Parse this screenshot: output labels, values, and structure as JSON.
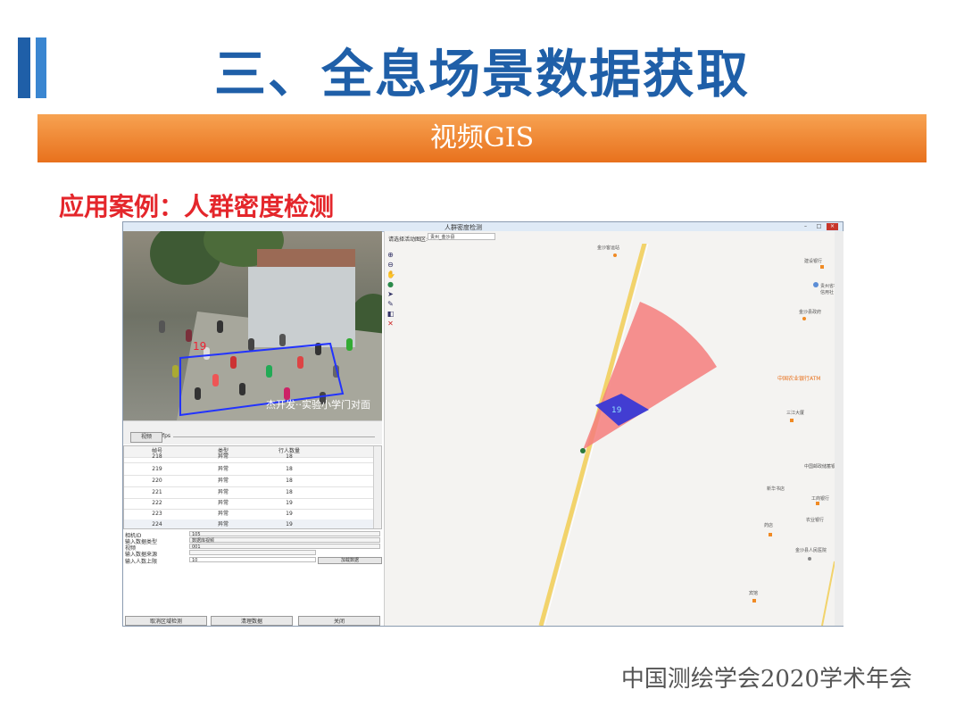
{
  "slide": {
    "title": "三、全息场景数据获取",
    "banner": "视频GIS",
    "case_label": "应用案例：人群密度检测",
    "footer": "中国测绘学会2020学术年会",
    "colors": {
      "title_blue": "#1f5fa8",
      "banner_orange": "#ef8a2c",
      "case_red": "#e4262b"
    }
  },
  "app": {
    "window_title": "人群密度检测",
    "window_buttons": {
      "minimize": "–",
      "maximize": "□",
      "close": "×"
    },
    "video": {
      "region_count": "19",
      "caption": "杰开发··实验小学门对面"
    },
    "controls": {
      "video_button": "视频",
      "fps_label": "fps"
    },
    "table": {
      "headers": [
        "帧号",
        "类型",
        "行人数量"
      ],
      "rows": [
        [
          "218",
          "异常",
          "18"
        ],
        [
          "219",
          "异常",
          "18"
        ],
        [
          "220",
          "异常",
          "18"
        ],
        [
          "221",
          "异常",
          "18"
        ],
        [
          "222",
          "异常",
          "19"
        ],
        [
          "223",
          "异常",
          "19"
        ],
        [
          "224",
          "异常",
          "19"
        ]
      ]
    },
    "form": {
      "camera_id_label": "相机ID",
      "camera_id_value": "105",
      "data_type_label": "输入数据类型",
      "data_type_value": "数据库视频",
      "video_label": "视频",
      "video_value": "001",
      "source_label": "输入数据来源",
      "source_value": "",
      "threshold_label": "输入人数上限",
      "threshold_value": "10",
      "browse_button": "加载数据"
    },
    "buttons": {
      "cancel_detect": "取消区域检测",
      "clear_data": "清理数据",
      "close": "关闭"
    },
    "map": {
      "district_label": "请选择活动图区:",
      "district_value": "贵州_金沙县",
      "tools": [
        "zoom-in-icon",
        "zoom-out-icon",
        "pan-icon",
        "globe-icon",
        "pointer-icon",
        "edit-icon",
        "layer-icon",
        "delete-icon"
      ],
      "region_count": "19",
      "pois": [
        {
          "name": "中国农业银行ATM"
        },
        {
          "name": "工商银行"
        },
        {
          "name": "金沙县政府"
        },
        {
          "name": "金沙县人民医院"
        },
        {
          "name": "三江大厦"
        },
        {
          "name": "中国邮政储蓄银行"
        },
        {
          "name": "建设银行"
        },
        {
          "name": "贵州省农村信用社"
        },
        {
          "name": "新华书店"
        },
        {
          "name": "农业银行"
        },
        {
          "name": "药店"
        },
        {
          "name": "宾馆"
        },
        {
          "name": "金沙客运站"
        }
      ]
    }
  }
}
